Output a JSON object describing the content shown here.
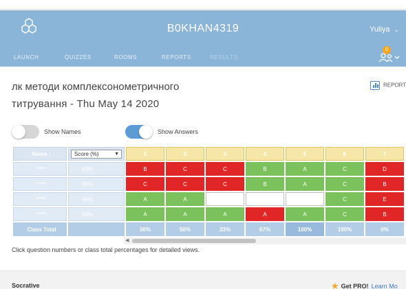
{
  "header": {
    "room_name": "B0KHAN4319",
    "user_name": "Yuliya",
    "notification_count": "0",
    "nav": [
      "LAUNCH",
      "QUIZZES",
      "ROOMS",
      "REPORTS",
      "RESULTS"
    ]
  },
  "quiz": {
    "title_line1": "лк методи комплексонометричного",
    "title_line2": "титрування - Thu May 14 2020",
    "report_label": "REPORT"
  },
  "toggles": {
    "show_names": {
      "label": "Show Names",
      "on": false
    },
    "show_answers": {
      "label": "Show Answers",
      "on": true
    }
  },
  "table": {
    "name_header": "Name ↑",
    "score_header": "Score (%)",
    "questions": [
      "1",
      "2",
      "3",
      "4",
      "5",
      "6",
      "7"
    ],
    "rows": [
      {
        "name": "*****",
        "score": "63%",
        "answers": [
          {
            "v": "B",
            "s": "red"
          },
          {
            "v": "C",
            "s": "red"
          },
          {
            "v": "C",
            "s": "red"
          },
          {
            "v": "B",
            "s": "green"
          },
          {
            "v": "A",
            "s": "green"
          },
          {
            "v": "C",
            "s": "green"
          },
          {
            "v": "D",
            "s": "red"
          }
        ]
      },
      {
        "name": "*****",
        "score": "69%",
        "answers": [
          {
            "v": "C",
            "s": "red"
          },
          {
            "v": "C",
            "s": "red"
          },
          {
            "v": "C",
            "s": "red"
          },
          {
            "v": "B",
            "s": "green"
          },
          {
            "v": "A",
            "s": "green"
          },
          {
            "v": "C",
            "s": "green"
          },
          {
            "v": "B",
            "s": "red"
          }
        ]
      },
      {
        "name": "*****",
        "score": "44%",
        "answers": [
          {
            "v": "A",
            "s": "green"
          },
          {
            "v": "A",
            "s": "green"
          },
          {
            "v": "",
            "s": "blank"
          },
          {
            "v": "",
            "s": "blank"
          },
          {
            "v": "",
            "s": "blank"
          },
          {
            "v": "C",
            "s": "green"
          },
          {
            "v": "E",
            "s": "red"
          }
        ]
      },
      {
        "name": "*****",
        "score": "56%",
        "answers": [
          {
            "v": "A",
            "s": "green"
          },
          {
            "v": "A",
            "s": "green"
          },
          {
            "v": "A",
            "s": "green"
          },
          {
            "v": "A",
            "s": "red"
          },
          {
            "v": "A",
            "s": "green"
          },
          {
            "v": "C",
            "s": "green"
          },
          {
            "v": "B",
            "s": "red"
          }
        ]
      }
    ],
    "total_label": "Class Total",
    "totals": [
      "50%",
      "50%",
      "33%",
      "67%",
      "100%",
      "100%",
      "0%"
    ]
  },
  "hint": "Click question numbers or class total percentages for detailed views.",
  "footer": {
    "brand": "Socrative",
    "get_pro": "Get PRO!",
    "learn_more": "Learn Mo"
  },
  "colors": {
    "header_bg": "#8ab4d8",
    "correct": "#7cc25c",
    "incorrect": "#e02626",
    "question_header": "#f6e7a8",
    "toggle_on": "#5c9bd6"
  }
}
